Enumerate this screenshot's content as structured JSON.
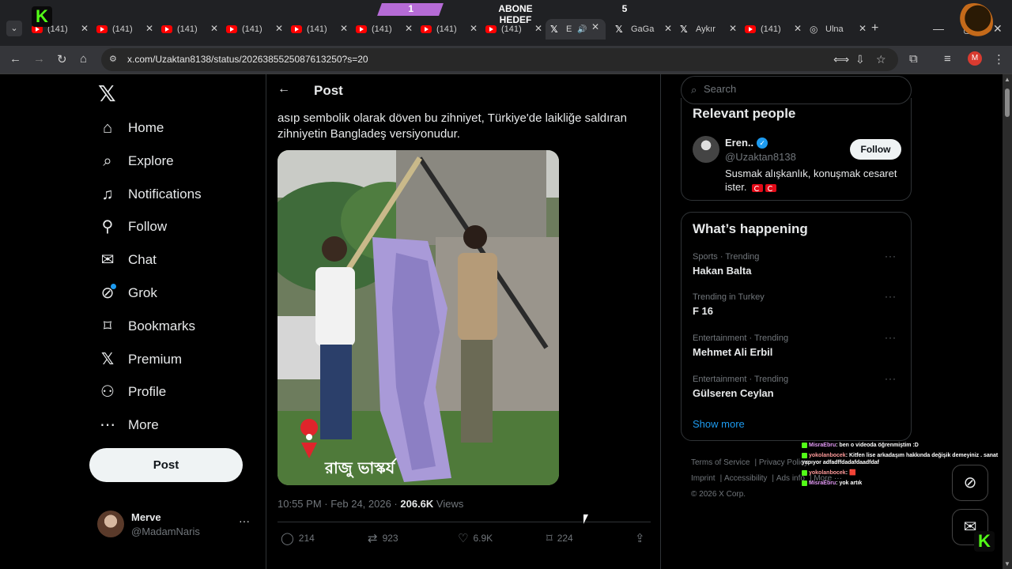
{
  "browser": {
    "tabs": [
      {
        "title": "(141)",
        "icon": "youtube-icon"
      },
      {
        "title": "(141)",
        "icon": "youtube-icon"
      },
      {
        "title": "(141)",
        "icon": "youtube-icon"
      },
      {
        "title": "(141)",
        "icon": "youtube-icon"
      },
      {
        "title": "(141)",
        "icon": "youtube-icon"
      },
      {
        "title": "(141)",
        "icon": "youtube-icon"
      },
      {
        "title": "(141)",
        "icon": "youtube-icon"
      },
      {
        "title": "(141)",
        "icon": "youtube-icon"
      },
      {
        "title": "E",
        "icon": "x-icon"
      },
      {
        "title": "GaGa",
        "icon": "x-icon"
      },
      {
        "title": "Aykır",
        "icon": "x-icon"
      },
      {
        "title": "(141)",
        "icon": "youtube-icon"
      },
      {
        "title": "Ulna",
        "icon": "globe-icon"
      }
    ],
    "url": "x.com/Uzaktan8138/status/2026385525087613250?s=20",
    "profile_initial": "M"
  },
  "stream_overlay": {
    "counter": "1",
    "goal_label": "ABONE HEDEF",
    "goal_value": "5"
  },
  "nav": {
    "items": [
      {
        "label": "Home",
        "icon": "home-icon"
      },
      {
        "label": "Explore",
        "icon": "search-icon"
      },
      {
        "label": "Notifications",
        "icon": "bell-icon"
      },
      {
        "label": "Follow",
        "icon": "add-person-icon"
      },
      {
        "label": "Chat",
        "icon": "mail-icon"
      },
      {
        "label": "Grok",
        "icon": "grok-icon"
      },
      {
        "label": "Bookmarks",
        "icon": "bookmark-icon"
      },
      {
        "label": "Premium",
        "icon": "x-icon"
      },
      {
        "label": "Profile",
        "icon": "person-icon"
      },
      {
        "label": "More",
        "icon": "more-circle-icon"
      }
    ],
    "post_button": "Post",
    "user": {
      "name": "Merve",
      "handle": "@MadamNaris"
    }
  },
  "post": {
    "header_title": "Post",
    "text": "asıp sembolik olarak döven bu zihniyet, Türkiye'de laikliğe saldıran zihniyetin Bangladeş versiyonudur.",
    "media_caption": "রাজু ভাস্কর্য",
    "time": "10:55 PM · Feb 24, 2026 · ",
    "views_count": "206.6K",
    "views_label": " Views",
    "replies": "214",
    "reposts": "923",
    "likes": "6.9K",
    "bookmarks": "224"
  },
  "sidebar": {
    "search_placeholder": "Search",
    "relevant_title": "Relevant people",
    "person": {
      "name": "Eren..",
      "handle": "@Uzaktan8138",
      "bio": "Susmak alışkanlık, konuşmak cesaret ister.",
      "follow_label": "Follow"
    },
    "happening_title": "What’s happening",
    "trends": [
      {
        "category": "Sports · Trending",
        "name": "Hakan Balta"
      },
      {
        "category": "Trending in Turkey",
        "name": "F 16"
      },
      {
        "category": "Entertainment · Trending",
        "name": "Mehmet Ali Erbil"
      },
      {
        "category": "Entertainment · Trending",
        "name": "Gülseren Ceylan"
      }
    ],
    "show_more": "Show more",
    "footer": {
      "terms": "Terms of Service",
      "privacy": "Privacy Policy",
      "imprint": "Imprint",
      "accessibility": "Accessibility",
      "ads": "Ads info",
      "more": "More ···",
      "copyright": "© 2026 X Corp."
    }
  },
  "chat": [
    {
      "user": "MisraEbru",
      "message": "ben o videoda öğrenmiştim :D"
    },
    {
      "user": "yokolanbocek",
      "message": "Kitfen lise arkadaşım hakkında değişik demeyiniz . sanat yapıyor adfadffdadafdaadfdaf"
    },
    {
      "user": "yokolanbocek",
      "message": "🟥"
    },
    {
      "user": "MisraEbru",
      "message": "yok artık"
    }
  ]
}
